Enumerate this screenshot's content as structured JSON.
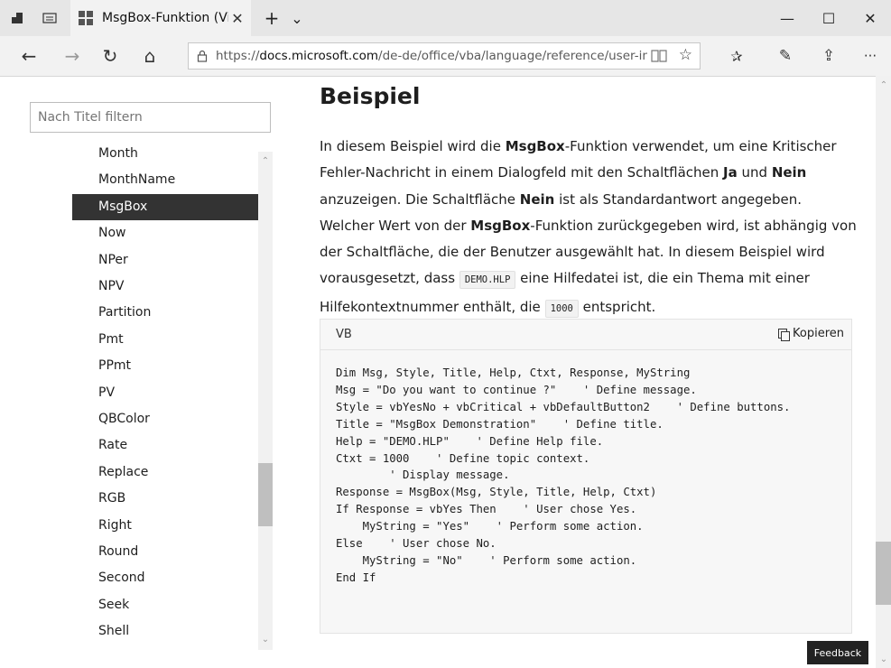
{
  "browser": {
    "tab_title": "MsgBox-Funktion (Visua",
    "tab_close": "✕",
    "new_tab": "+",
    "tab_list": "⌄",
    "minimize": "—",
    "maximize": "☐",
    "close": "✕",
    "back": "←",
    "forward": "→",
    "refresh": "↻",
    "home": "⌂",
    "url_prefix": "https://",
    "url_host": "docs.microsoft.com",
    "url_path": "/de-de/office/vba/language/reference/user-inte",
    "favorite": "☆",
    "favorites_hub": "✰",
    "notes": "✎",
    "share": "⇪",
    "more": "···"
  },
  "sidebar": {
    "filter_placeholder": "Nach Titel filtern",
    "items": [
      "Month",
      "MonthName",
      "MsgBox",
      "Now",
      "NPer",
      "NPV",
      "Partition",
      "Pmt",
      "PPmt",
      "PV",
      "QBColor",
      "Rate",
      "Replace",
      "RGB",
      "Right",
      "Round",
      "Second",
      "Seek",
      "Shell"
    ],
    "active_index": 2
  },
  "content": {
    "heading": "Beispiel",
    "p1": "In diesem Beispiel wird die ",
    "b1": "MsgBox",
    "p2": "-Funktion verwendet, um eine Kritischer Fehler-Nachricht in einem Dialogfeld mit den Schaltflächen ",
    "b2": "Ja",
    "p3": " und ",
    "b3": "Nein",
    "p4": " anzuzeigen. Die Schaltfläche ",
    "b4": "Nein",
    "p5": " ist als Standardantwort angegeben. Welcher Wert von der ",
    "b5": "MsgBox",
    "p6": "-Funktion zurückgegeben wird, ist abhängig von der Schaltfläche, die der Benutzer ausgewählt hat. In diesem Beispiel wird vorausgesetzt, dass ",
    "c1": "DEMO.HLP",
    "p7": " eine Hilfedatei ist, die ein Thema mit einer Hilfekontextnummer enthält, die ",
    "c2": "1000",
    "p8": " entspricht."
  },
  "code": {
    "language": "VB",
    "copy_label": "Kopieren",
    "text": "Dim Msg, Style, Title, Help, Ctxt, Response, MyString\nMsg = \"Do you want to continue ?\"    ' Define message.\nStyle = vbYesNo + vbCritical + vbDefaultButton2    ' Define buttons.\nTitle = \"MsgBox Demonstration\"    ' Define title.\nHelp = \"DEMO.HLP\"    ' Define Help file.\nCtxt = 1000    ' Define topic context.\n        ' Display message.\nResponse = MsgBox(Msg, Style, Title, Help, Ctxt)\nIf Response = vbYes Then    ' User chose Yes.\n    MyString = \"Yes\"    ' Perform some action.\nElse    ' User chose No.\n    MyString = \"No\"    ' Perform some action.\nEnd If"
  },
  "feedback_label": "Feedback"
}
